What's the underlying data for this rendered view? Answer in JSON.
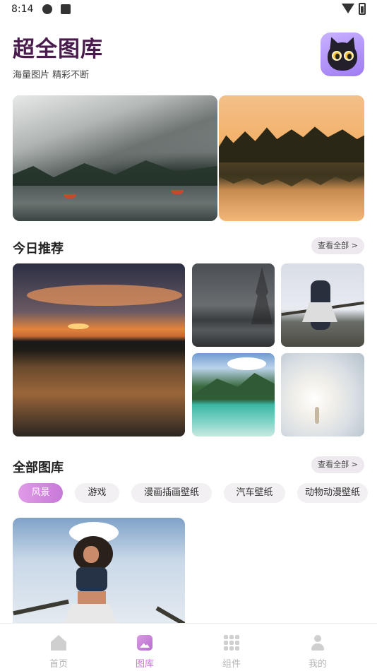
{
  "status_bar": {
    "time": "8:14"
  },
  "header": {
    "title": "超全图库",
    "subtitle": "海量图片 精彩不断",
    "logo_icon": "black-cat-avatar"
  },
  "sections": {
    "today": {
      "title": "今日推荐",
      "see_all": "查看全部 >"
    },
    "all": {
      "title": "全部图库",
      "see_all": "查看全部 >"
    }
  },
  "categories": [
    {
      "label": "风景",
      "active": true
    },
    {
      "label": "游戏",
      "active": false
    },
    {
      "label": "漫画插画壁纸",
      "active": false
    },
    {
      "label": "汽车壁纸",
      "active": false
    },
    {
      "label": "动物动漫壁纸",
      "active": false
    }
  ],
  "bottom_nav": [
    {
      "label": "首页",
      "icon": "home-icon",
      "active": false
    },
    {
      "label": "图库",
      "icon": "gallery-icon",
      "active": true
    },
    {
      "label": "组件",
      "icon": "grid-icon",
      "active": false
    },
    {
      "label": "我的",
      "icon": "user-icon",
      "active": false
    }
  ],
  "colors": {
    "accent": "#c779d8",
    "title": "#4a1c4d"
  }
}
